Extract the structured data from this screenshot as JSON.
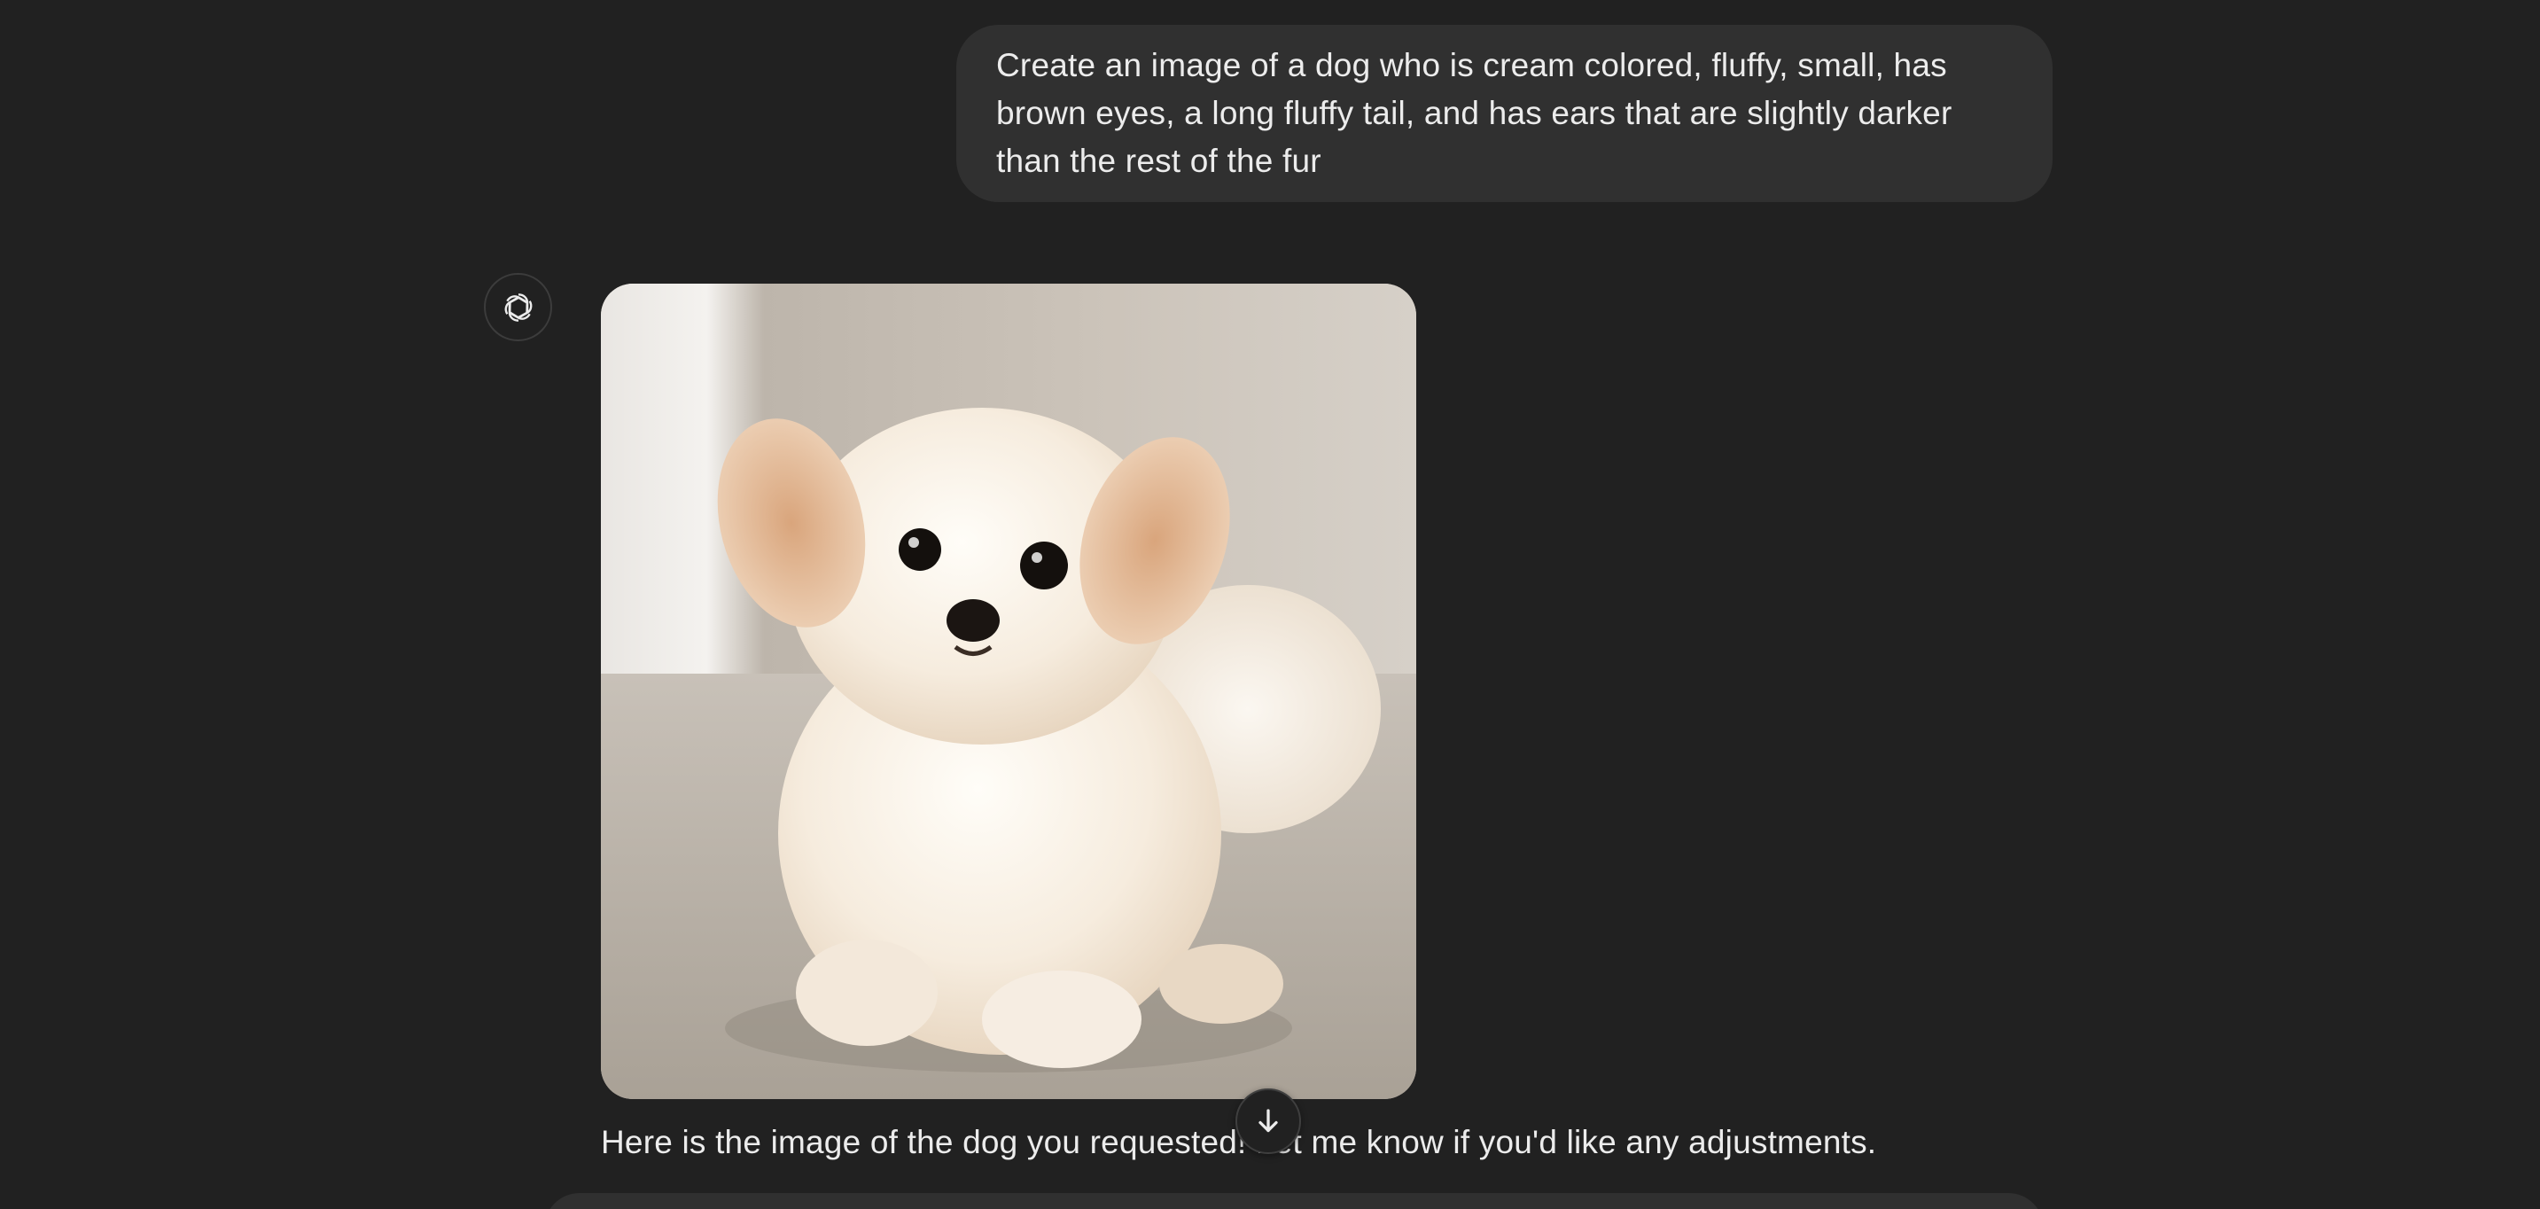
{
  "user_message": {
    "text": "Create an image of a dog who is cream colored, fluffy, small, has brown eyes, a long fluffy tail, and has ears that are slightly darker than the rest of the fur"
  },
  "assistant": {
    "avatar_icon": "openai-logo-icon",
    "image_subject": "fluffy-cream-puppy",
    "reply": "Here is the image of the dog you requested! Let me know if you'd like any adjustments."
  },
  "scroll_button_icon": "arrow-down-icon",
  "colors": {
    "background": "#212121",
    "bubble": "#303030",
    "text": "#ececec"
  }
}
